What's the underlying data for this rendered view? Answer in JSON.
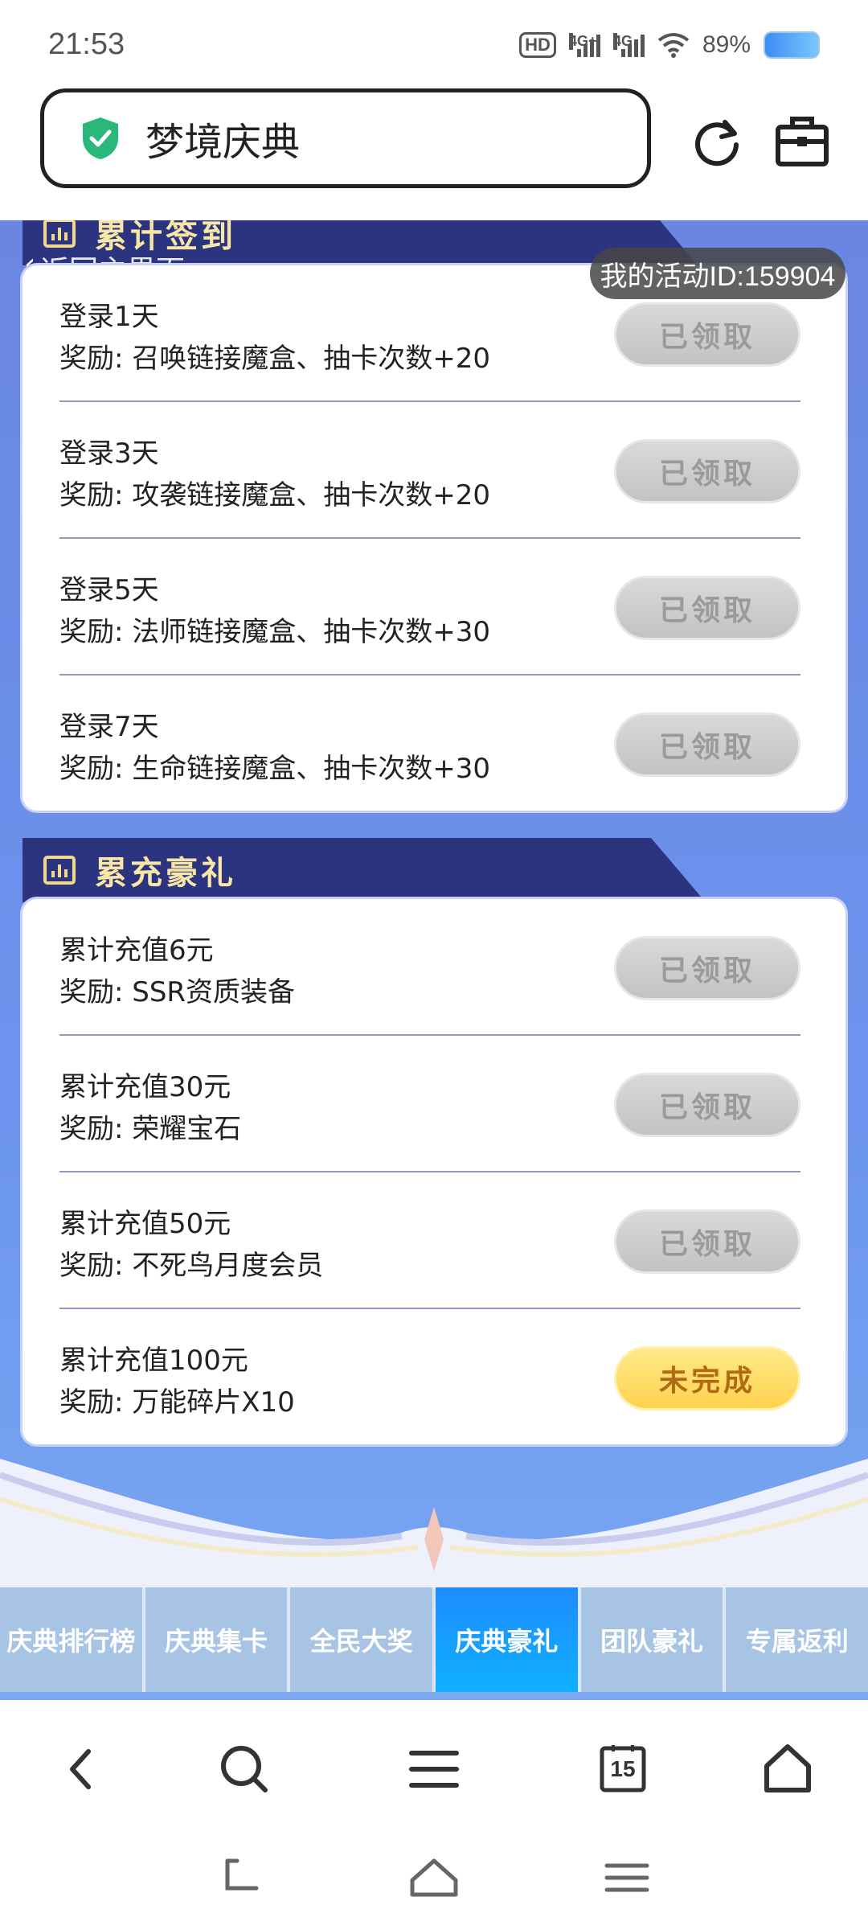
{
  "status_bar": {
    "time": "21:53",
    "hd_label": "HD",
    "signal1_label": "4G+",
    "signal2_label": "4G",
    "battery_text": "89%"
  },
  "browser": {
    "address_text": "梦境庆典",
    "icons": [
      "shield-check-icon",
      "reload-icon",
      "toolbox-icon"
    ]
  },
  "page": {
    "back_label": "返回主界面",
    "activity_id": "我的活动ID:159904"
  },
  "signin_section": {
    "title": "累计签到",
    "rows": [
      {
        "title": "登录1天",
        "reward": "奖励: 召唤链接魔盒、抽卡次数+20",
        "status": "已领取"
      },
      {
        "title": "登录3天",
        "reward": "奖励: 攻袭链接魔盒、抽卡次数+20",
        "status": "已领取"
      },
      {
        "title": "登录5天",
        "reward": "奖励: 法师链接魔盒、抽卡次数+30",
        "status": "已领取"
      },
      {
        "title": "登录7天",
        "reward": "奖励: 生命链接魔盒、抽卡次数+30",
        "status": "已领取"
      }
    ]
  },
  "recharge_section": {
    "title": "累充豪礼",
    "rows": [
      {
        "title": "累计充值6元",
        "reward": "奖励: SSR资质装备",
        "status": "已领取"
      },
      {
        "title": "累计充值30元",
        "reward": "奖励: 荣耀宝石",
        "status": "已领取"
      },
      {
        "title": "累计充值50元",
        "reward": "奖励: 不死鸟月度会员",
        "status": "已领取"
      },
      {
        "title": "累计充值100元",
        "reward": "奖励: 万能碎片X10",
        "status": "未完成"
      }
    ]
  },
  "tabs": [
    {
      "label": "庆典排行榜",
      "active": false
    },
    {
      "label": "庆典集卡",
      "active": false
    },
    {
      "label": "全民大奖",
      "active": false
    },
    {
      "label": "庆典豪礼",
      "active": true
    },
    {
      "label": "团队豪礼",
      "active": false
    },
    {
      "label": "专属返利",
      "active": false
    }
  ],
  "bottom_nav": {
    "tab_count": "15",
    "icons": [
      "back-icon",
      "search-icon",
      "menu-icon",
      "tabs-icon",
      "home-icon"
    ]
  },
  "colors": {
    "section_header": "#2c3480",
    "section_title": "#f8e6a6",
    "content_bg": "#6c8ce6",
    "active_tab": "#1e8cff",
    "pending_button": "#ffd24d"
  }
}
